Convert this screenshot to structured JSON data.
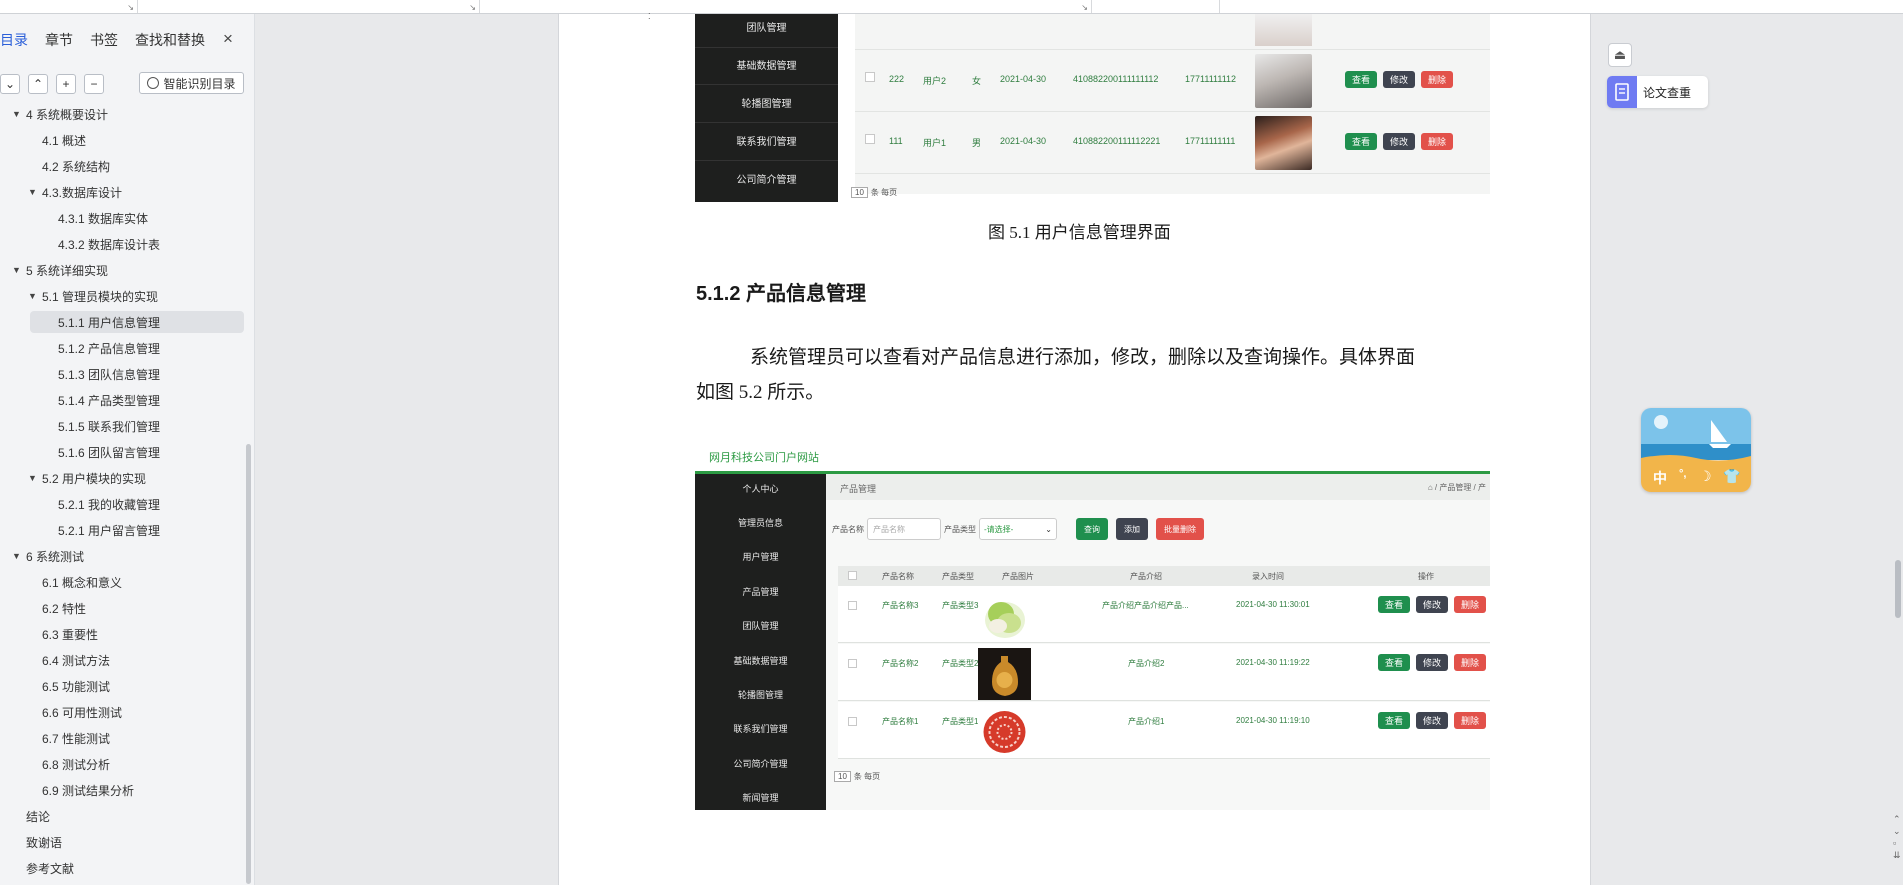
{
  "nav": {
    "tabs": [
      "目录",
      "章节",
      "书签",
      "查找和替换"
    ],
    "close_icon": "×",
    "smart_toc_label": "智能识别目录",
    "toc": [
      {
        "label": "4 系统概要设计",
        "level": 1,
        "arrow": "▼"
      },
      {
        "label": "4.1 概述",
        "level": 2
      },
      {
        "label": "4.2 系统结构",
        "level": 2
      },
      {
        "label": "4.3.数据库设计",
        "level": 2,
        "arrow": "▼"
      },
      {
        "label": "4.3.1 数据库实体",
        "level": 3
      },
      {
        "label": "4.3.2 数据库设计表",
        "level": 3
      },
      {
        "label": "5 系统详细实现",
        "level": 1,
        "arrow": "▼"
      },
      {
        "label": "5.1  管理员模块的实现",
        "level": 2,
        "arrow": "▼"
      },
      {
        "label": "5.1.1  用户信息管理",
        "level": 3,
        "selected": true
      },
      {
        "label": "5.1.2  产品信息管理",
        "level": 3
      },
      {
        "label": "5.1.3  团队信息管理",
        "level": 3
      },
      {
        "label": "5.1.4  产品类型管理",
        "level": 3
      },
      {
        "label": "5.1.5  联系我们管理",
        "level": 3
      },
      {
        "label": "5.1.6  团队留言管理",
        "level": 3
      },
      {
        "label": "5.2  用户模块的实现",
        "level": 2,
        "arrow": "▼"
      },
      {
        "label": "5.2.1  我的收藏管理",
        "level": 3
      },
      {
        "label": "5.2.1  用户留言管理",
        "level": 3
      },
      {
        "label": "6 系统测试",
        "level": 1,
        "arrow": "▼"
      },
      {
        "label": "6.1 概念和意义",
        "level": 2
      },
      {
        "label": "6.2 特性",
        "level": 2
      },
      {
        "label": "6.3 重要性",
        "level": 2
      },
      {
        "label": "6.4 测试方法",
        "level": 2
      },
      {
        "label": "6.5  功能测试",
        "level": 2
      },
      {
        "label": "6.6 可用性测试",
        "level": 2
      },
      {
        "label": "6.7 性能测试",
        "level": 2
      },
      {
        "label": "6.8 测试分析",
        "level": 2
      },
      {
        "label": "6.9 测试结果分析",
        "level": 2
      },
      {
        "label": "结论",
        "level": 1
      },
      {
        "label": "致谢语",
        "level": 1
      },
      {
        "label": "参考文献",
        "level": 1
      }
    ]
  },
  "doc": {
    "fig1_caption": "图 5.1  用户信息管理界面",
    "section_heading": "5.1.2  产品信息管理",
    "para_line1": "系统管理员可以查看对产品信息进行添加，修改，删除以及查询操作。具体界面",
    "para_line2": "如图 5.2 所示。"
  },
  "shot1": {
    "menu": [
      "团队管理",
      "基础数据管理",
      "轮播图管理",
      "联系我们管理",
      "公司简介管理"
    ],
    "rows": [
      {
        "id": "222",
        "name": "用户2",
        "gender": "女",
        "date": "2021-04-30",
        "idcard": "410882200111111112",
        "phone": "17711111112"
      },
      {
        "id": "111",
        "name": "用户1",
        "gender": "男",
        "date": "2021-04-30",
        "idcard": "410882200111112221",
        "phone": "17711111111"
      }
    ],
    "pager_size": "10",
    "pager_label": "条 每页"
  },
  "shot2": {
    "site_title": "网月科技公司门户网站",
    "menu": [
      "个人中心",
      "管理员信息",
      "用户管理",
      "产品管理",
      "团队管理",
      "基础数据管理",
      "轮播图管理",
      "联系我们管理",
      "公司简介管理",
      "新闻管理"
    ],
    "breadcrumb": "产品管理",
    "breadcrumb_right": "⌂ / 产品管理 / 产",
    "filter_name_label": "产品名称",
    "filter_name_placeholder": "产品名称",
    "filter_type_label": "产品类型",
    "filter_type_value": "-请选择-",
    "btn_query": "查询",
    "btn_add": "添加",
    "btn_batch_delete": "批量删除",
    "columns": [
      "产品名称",
      "产品类型",
      "产品图片",
      "产品介绍",
      "录入时间",
      "操作"
    ],
    "rows": [
      {
        "name": "产品名称3",
        "type": "产品类型3",
        "intro": "产品介绍产品介绍产品...",
        "time": "2021-04-30 11:30:01"
      },
      {
        "name": "产品名称2",
        "type": "产品类型2",
        "intro": "产品介绍2",
        "time": "2021-04-30 11:19:22"
      },
      {
        "name": "产品名称1",
        "type": "产品类型1",
        "intro": "产品介绍1",
        "time": "2021-04-30 11:19:10"
      }
    ],
    "pager_size": "10",
    "pager_label": "条 每页"
  },
  "ops": {
    "view": "查看",
    "edit": "修改",
    "delete": "删除"
  },
  "right_panel": {
    "plagiarism_label": "论文查重",
    "ime_glyphs": [
      "中",
      "°,",
      "☽",
      "👕"
    ]
  },
  "colors": {
    "accent": "#2b5fd9",
    "brand_green": "#2c9a43",
    "view_btn": "#1f8f4e",
    "edit_btn": "#3f4450",
    "delete_btn": "#e2514a"
  }
}
